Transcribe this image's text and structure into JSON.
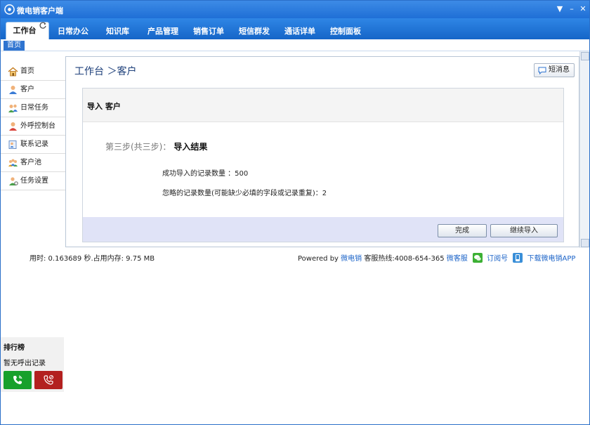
{
  "app": {
    "title": "微电销客户端"
  },
  "window_controls": {
    "menu": "▼",
    "minimize": "–",
    "close": "✕"
  },
  "nav": {
    "active_tab": "工作台",
    "tabs": [
      "日常办公",
      "知识库",
      "产品管理",
      "销售订单",
      "短信群发",
      "通话详单",
      "控制面板"
    ]
  },
  "breadcrumb": {
    "home": "首页"
  },
  "sidebar": {
    "items": [
      {
        "label": "首页",
        "icon": "home-icon"
      },
      {
        "label": "客户",
        "icon": "customer-icon"
      },
      {
        "label": "日常任务",
        "icon": "task-icon"
      },
      {
        "label": "外呼控制台",
        "icon": "agent-icon"
      },
      {
        "label": "联系记录",
        "icon": "contact-record-icon"
      },
      {
        "label": "客户池",
        "icon": "customer-pool-icon"
      },
      {
        "label": "任务设置",
        "icon": "task-settings-icon"
      }
    ]
  },
  "main": {
    "title": "工作台 ＞客户",
    "message_button": "短消息",
    "panel_title": "导入 客户",
    "step_label": "第三步(共三步)：",
    "step_name": "导入结果",
    "imported_line": "成功导入的记录数量 ：500",
    "ignored_line": "忽略的记录数量(可能缺少必填的字段或记录重复)：2",
    "done_button": "完成",
    "continue_button": "继续导入"
  },
  "status": {
    "left": "用时: 0.163689 秒.占用内存: 9.75 MB",
    "powered_by": "Powered by",
    "brand": "微电销",
    "hotline": "客服热线:4008-654-365",
    "service_link": "微客服",
    "subscribe_link": "订阅号",
    "app_link": "下载微电销APP"
  },
  "ranking": {
    "title": "排行榜",
    "empty_text": "暂无呼出记录"
  },
  "colors": {
    "title_bar": "#1f6fd6",
    "accent": "#2f74d0",
    "call_green": "#17a02b",
    "call_red": "#b3201f"
  }
}
